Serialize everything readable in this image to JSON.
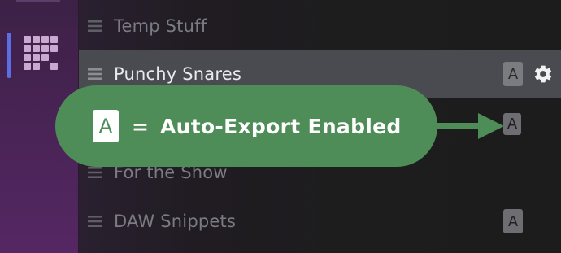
{
  "sidebar": {
    "icon": "grid-icon",
    "active_color": "#5b6fe2"
  },
  "list": {
    "items": [
      {
        "label": "Temp Stuff",
        "badge": "",
        "selected": false
      },
      {
        "label": "Punchy Snares",
        "badge": "A",
        "selected": true,
        "settings_icon": "gear-icon"
      },
      {
        "label": "",
        "badge": "A",
        "selected": false
      },
      {
        "label": "For the Show",
        "badge": "",
        "selected": false
      },
      {
        "label": "DAW Snippets",
        "badge": "A",
        "selected": false
      }
    ]
  },
  "callout": {
    "badge": "A",
    "equals": "=",
    "text": "Auto-Export Enabled",
    "color": "#4e8c58"
  }
}
